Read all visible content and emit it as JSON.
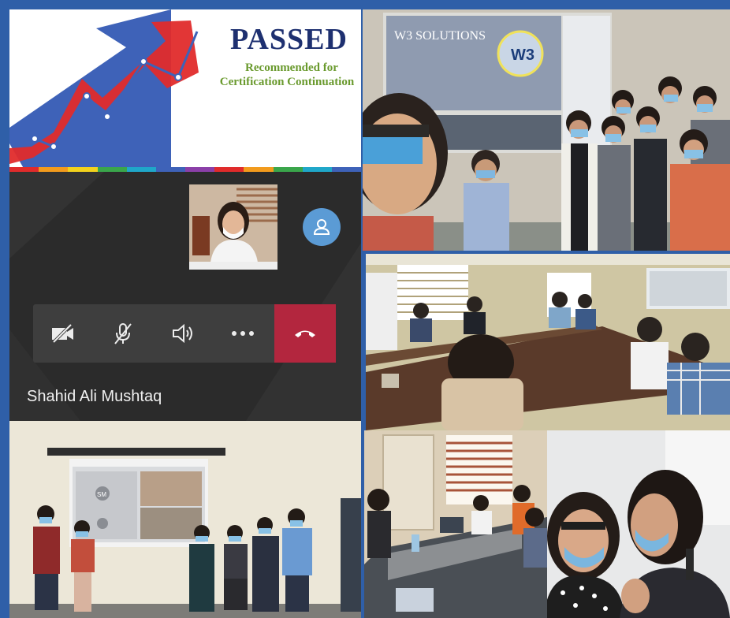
{
  "banner": {
    "title": "PASSED",
    "subtitle_line1": "Recommended for",
    "subtitle_line2": "Certification Continuation",
    "colors": {
      "navy": "#1e3070",
      "arrow_blue": "#3e62b8",
      "arrow_red": "#e02b2b",
      "green": "#6a9a2e"
    }
  },
  "meeting": {
    "participant_name": "Shahid Ali Mushtaq",
    "controls": [
      {
        "name": "camera-off-icon"
      },
      {
        "name": "mic-off-icon"
      },
      {
        "name": "speaker-icon"
      },
      {
        "name": "more-options-icon"
      },
      {
        "name": "end-call-icon"
      }
    ],
    "end_call_color": "#b3263e"
  },
  "projection": {
    "slide_title": "W3 SOLUTIONS",
    "logo_text": "W3",
    "initials": "SM"
  }
}
